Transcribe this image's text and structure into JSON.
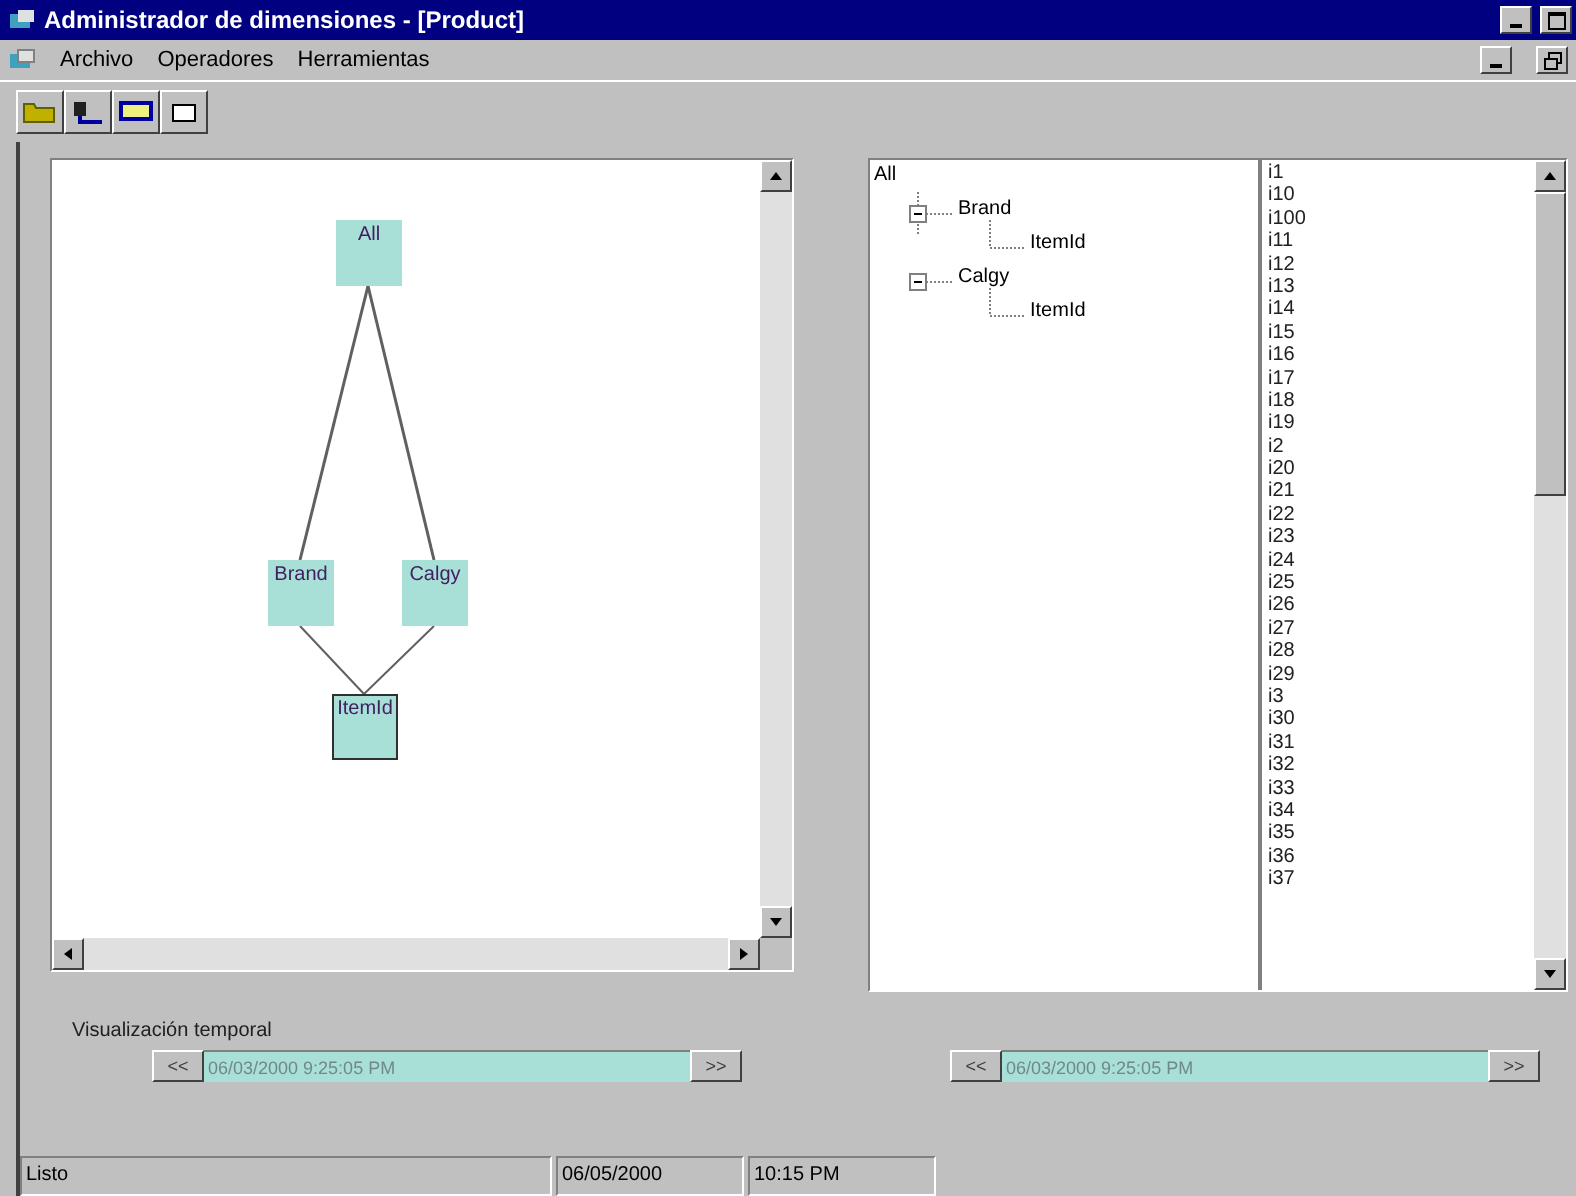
{
  "window": {
    "title": "Administrador de dimensiones - [Product]"
  },
  "menu": [
    "Archivo",
    "Operadores",
    "Herramientas"
  ],
  "diagram": {
    "nodes": [
      {
        "label": "All",
        "selected": false
      },
      {
        "label": "Brand",
        "selected": false
      },
      {
        "label": "Calgy",
        "selected": false
      },
      {
        "label": "ItemId",
        "selected": true
      }
    ]
  },
  "tree": {
    "label": "All",
    "children": [
      {
        "label": "Brand",
        "expanded": true,
        "children": [
          {
            "label": "ItemId"
          }
        ]
      },
      {
        "label": "Calgy",
        "expanded": true,
        "children": [
          {
            "label": "ItemId"
          }
        ]
      }
    ]
  },
  "list": [
    "i1",
    "i10",
    "i100",
    "i11",
    "i12",
    "i13",
    "i14",
    "i15",
    "i16",
    "i17",
    "i18",
    "i19",
    "i2",
    "i20",
    "i21",
    "i22",
    "i23",
    "i24",
    "i25",
    "i26",
    "i27",
    "i28",
    "i29",
    "i3",
    "i30",
    "i31",
    "i32",
    "i33",
    "i34",
    "i35",
    "i36",
    "i37"
  ],
  "timeline": {
    "label": "Visualización temporal",
    "sliders": [
      {
        "prev": "<<",
        "value": "06/03/2000 9:25:05 PM",
        "next": ">>",
        "level": 1
      },
      {
        "prev": "<<",
        "value": "06/03/2000 9:25:05 PM",
        "next": ">>",
        "level": 1
      }
    ]
  },
  "status_bar": [
    "Listo",
    "06/05/2000",
    "10:15 PM"
  ]
}
